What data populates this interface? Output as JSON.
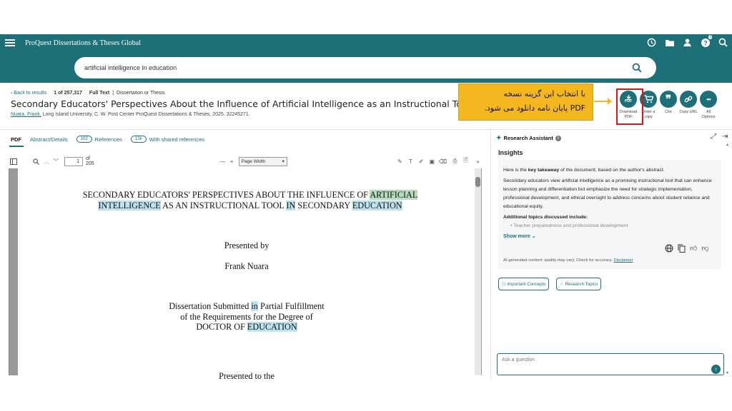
{
  "app": {
    "brand": "ProQuest Dissertations & Theses Global",
    "color_primary": "#1d6f78",
    "color_highlight": "#bfe3ee",
    "color_callout": "#f4b71f",
    "color_annotation_box": "#d9141a"
  },
  "topbar": {
    "icons": [
      "history-icon",
      "folder-icon",
      "user-icon",
      "help-icon",
      "search-icon"
    ],
    "help_badge": "9"
  },
  "search": {
    "query": "artificial intelligence in education"
  },
  "record": {
    "back_label": "Back to results",
    "position": "1",
    "total": "of 257,317",
    "fulltext_label": "Full Text",
    "separator": "|",
    "doc_type": "Dissertation or Thesis",
    "title": "Secondary Educators' Perspectives About the Influence of Artificial Intelligence as an Instructional Tool in Secondary Education",
    "author": "Nuara, Frank.",
    "source": "Long Island University, C. W. Post Center ProQuest Dissertations & Theses, 2025. 32245271."
  },
  "callout": {
    "line1": "با انتخاب این گزینه نسخه",
    "line2": "PDF پایان نامه دانلود می شود."
  },
  "actions": [
    {
      "label_line1": "Download",
      "label_line2": "PDF",
      "glyph": "PDF",
      "icon": "download-pdf-icon"
    },
    {
      "label_line1": "Order a",
      "label_line2": "copy",
      "glyph": "🛒",
      "icon": "cart-icon"
    },
    {
      "label_line1": "Cite",
      "label_line2": "",
      "glyph": "❞",
      "icon": "quote-icon"
    },
    {
      "label_line1": "Copy URL",
      "label_line2": "",
      "glyph": "🔗",
      "icon": "link-icon"
    },
    {
      "label_line1": "All",
      "label_line2": "Options",
      "glyph": "•••",
      "icon": "more-icon"
    }
  ],
  "tabs": {
    "pdf": "PDF",
    "abstract": "Abstract/Details",
    "references_count": "102",
    "references": "References",
    "shared_count": "13k",
    "shared": "With shared references"
  },
  "pdf_toolbar": {
    "page": "1",
    "of_pages": "of 205",
    "zoom": "Page Width"
  },
  "pdf_page": {
    "title_pre": "SECONDARY EDUCATORS' PERSPECTIVES ABOUT THE INFLUENCE OF ",
    "title_hl1": "ARTIFICIAL",
    "title_hl2": "INTELLIGENCE",
    "title_mid": " AS AN INSTRUCTIONAL TOOL ",
    "title_hl3": "IN",
    "title_mid2": " SECONDARY ",
    "title_hl4": "EDUCATION",
    "presented_by": "Presented by",
    "author": "Frank Nuara",
    "submitted_pre": "Dissertation Submitted ",
    "submitted_hl": "in",
    "submitted_post": " Partial Fulfillment",
    "requirements": "of the Requirements for the Degree of",
    "degree_pre": "DOCTOR OF ",
    "degree_hl": "EDUCATION",
    "cut_line": "Presented to the"
  },
  "assistant": {
    "title": "Research Assistant",
    "insights": "Insights",
    "intro_pre": "Here is the ",
    "intro_bold": "key takeaway",
    "intro_post": " of the document, based on the author's abstract.",
    "summary": "Secondary educators view artificial intelligence as a promising instructional tool that can enhance lesson planning and differentiation but emphasize the need for strategic implementation, professional development, and ethical oversight to address concerns about student reliance and educational equity.",
    "additional": "Additional topics discussed include:",
    "bullet1": "Teacher preparedness and professional development",
    "show_more": "Show more",
    "disclaimer": "AI-generated content: quality may vary. Check for accuracy.",
    "disclaimer_link": "Disclaimer",
    "chip1": "Important Concepts",
    "chip2": "Research Topics",
    "ask_placeholder": "Ask a question"
  }
}
